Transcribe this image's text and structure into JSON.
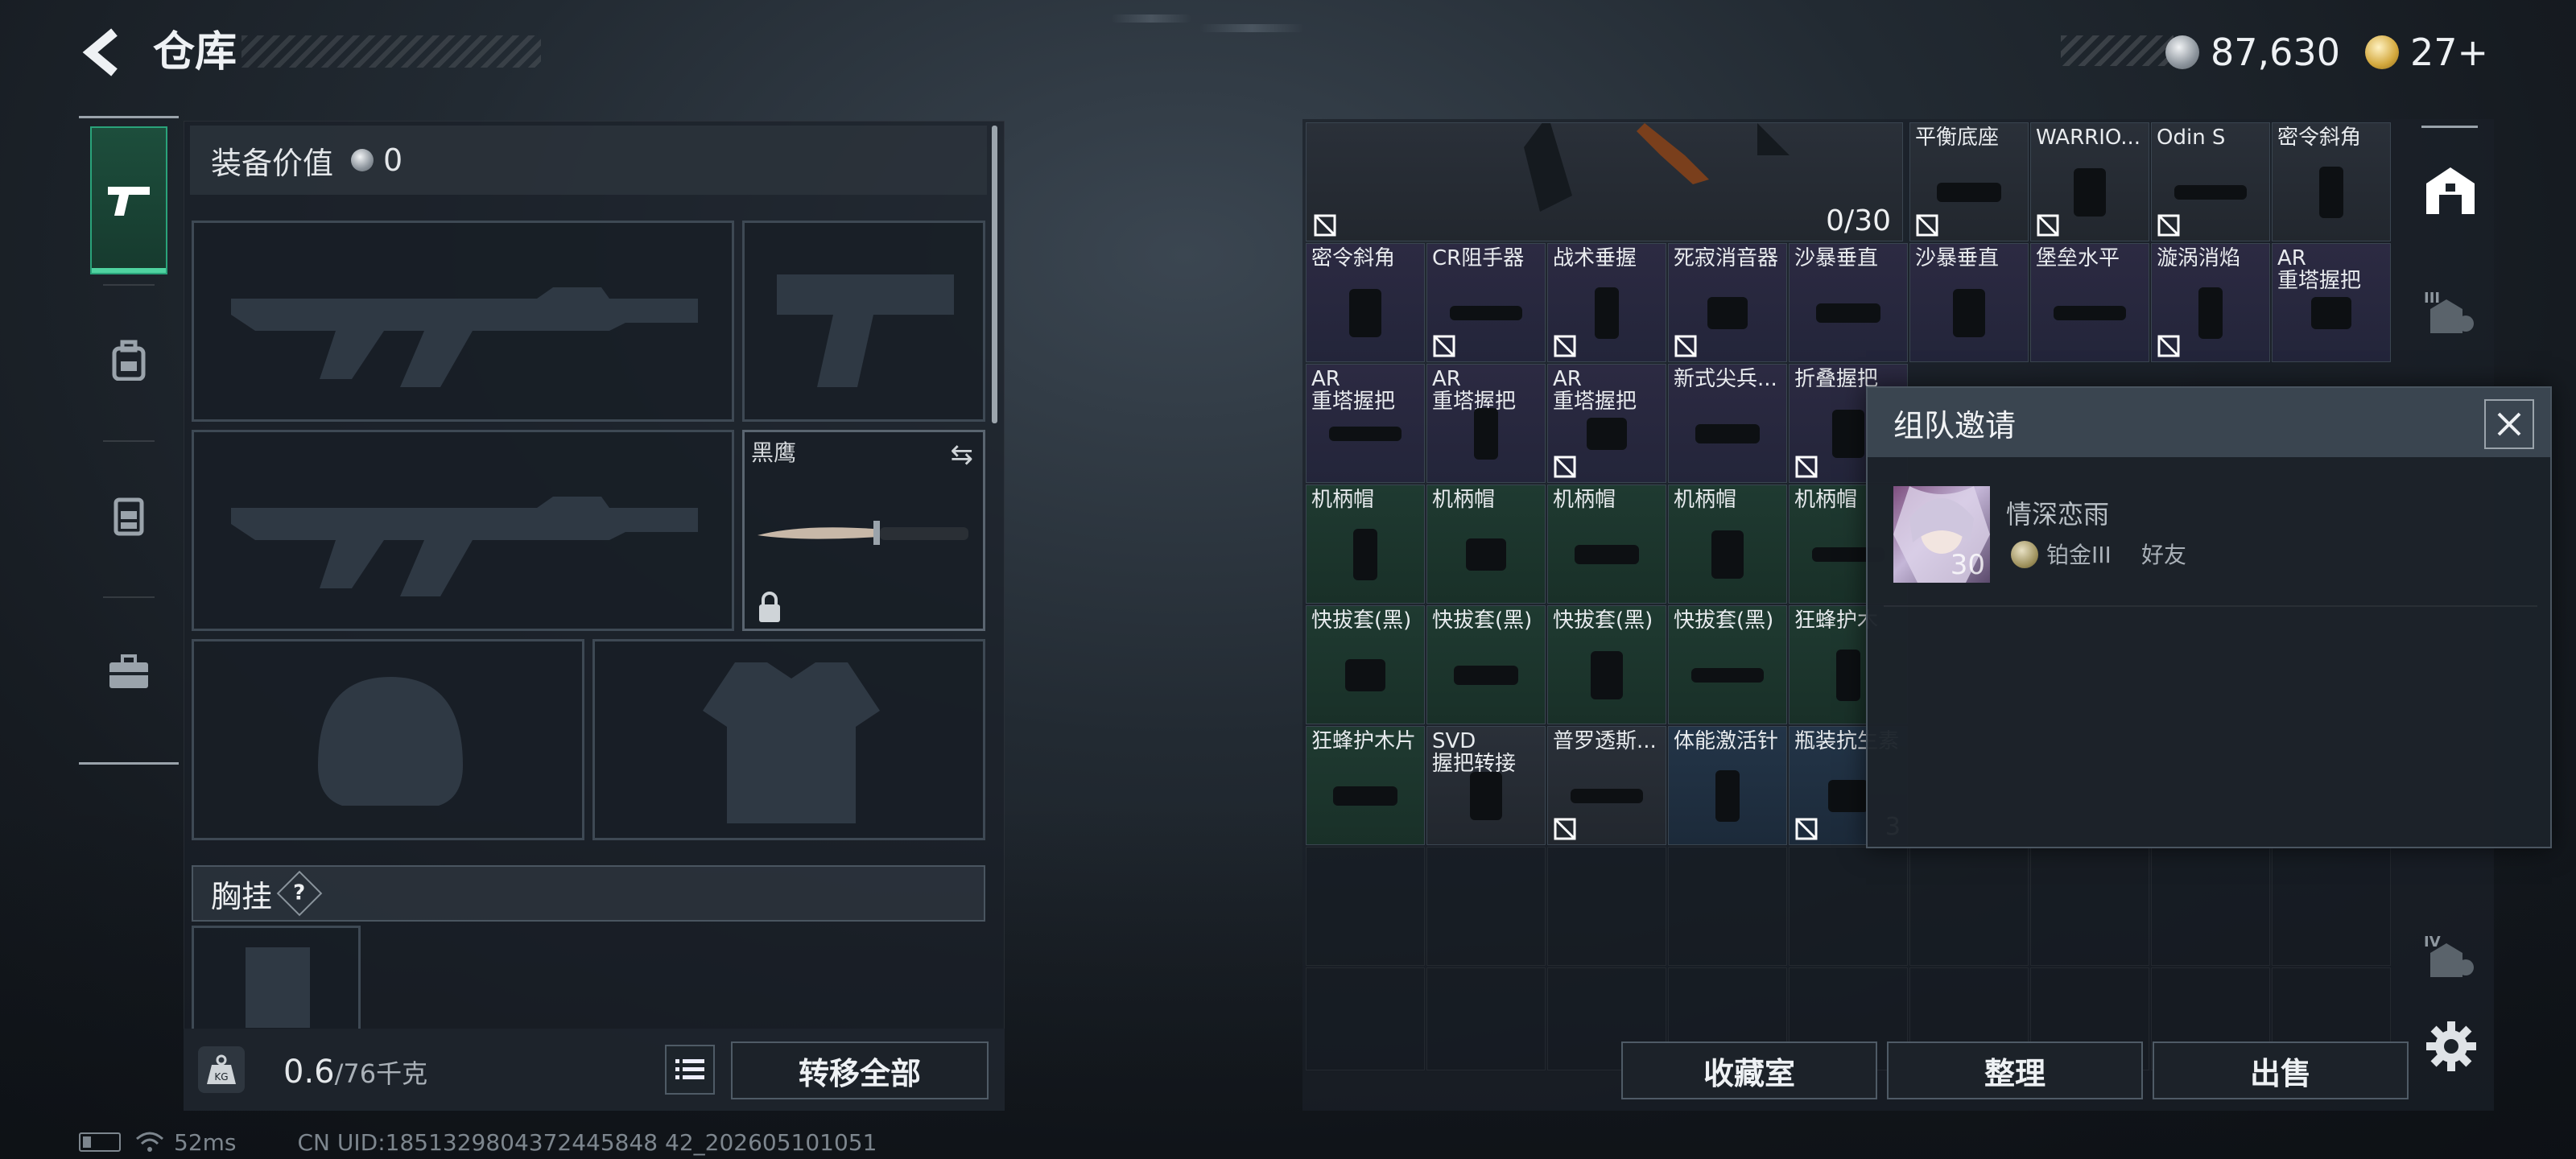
{
  "header": {
    "title": "仓库",
    "currency_silver": "87,630",
    "currency_gold": "27+"
  },
  "left_nav": {
    "items": [
      "weapon-icon",
      "backpack-icon",
      "chest-rig-icon",
      "toolbox-icon"
    ]
  },
  "equipment": {
    "value_label": "装备价值",
    "value": "0",
    "knife_label": "黑鹰",
    "chest_rig_label": "胸挂",
    "weight": "0.6",
    "weight_max": "/76千克",
    "transfer_all": "转移全部"
  },
  "grid": {
    "big_item_count": "0/30",
    "row1": [
      "平衡底座",
      "WARRIO...",
      "Odin S",
      "密令斜角"
    ],
    "row2": [
      "密令斜角",
      "CR阻手器",
      "战术垂握",
      "死寂消音器",
      "沙暴垂直",
      "沙暴垂直",
      "堡垒水平",
      "漩涡消焰",
      "AR\n重塔握把"
    ],
    "row3": [
      "AR\n重塔握把",
      "AR\n重塔握把",
      "AR\n重塔握把",
      "新式尖兵...",
      "折叠握把"
    ],
    "row4": [
      "机柄帽",
      "机柄帽",
      "机柄帽",
      "机柄帽",
      "机柄帽"
    ],
    "row5": [
      "快拔套(黑)",
      "快拔套(黑)",
      "快拔套(黑)",
      "快拔套(黑)",
      "狂蜂护木"
    ],
    "row6": [
      "狂蜂护木片",
      "SVD\n握把转接",
      "普罗透斯...",
      "体能激活针",
      "瓶装抗生素"
    ],
    "row6_count": "3"
  },
  "bottom_buttons": {
    "collection": "收藏室",
    "sort": "整理",
    "sell": "出售"
  },
  "right_nav": {
    "items": [
      "safehouse-icon",
      "tier-III-icon",
      "tier-IV-icon",
      "settings-icon"
    ],
    "tier3": "III",
    "tier4": "IV"
  },
  "popup": {
    "title": "组队邀请",
    "player_name": "情深恋雨",
    "level": "30",
    "rank": "铂金III",
    "relation": "好友"
  },
  "status": {
    "ping": "52ms",
    "uid": "CN UID:1851329804372445848 42_202605101051"
  }
}
